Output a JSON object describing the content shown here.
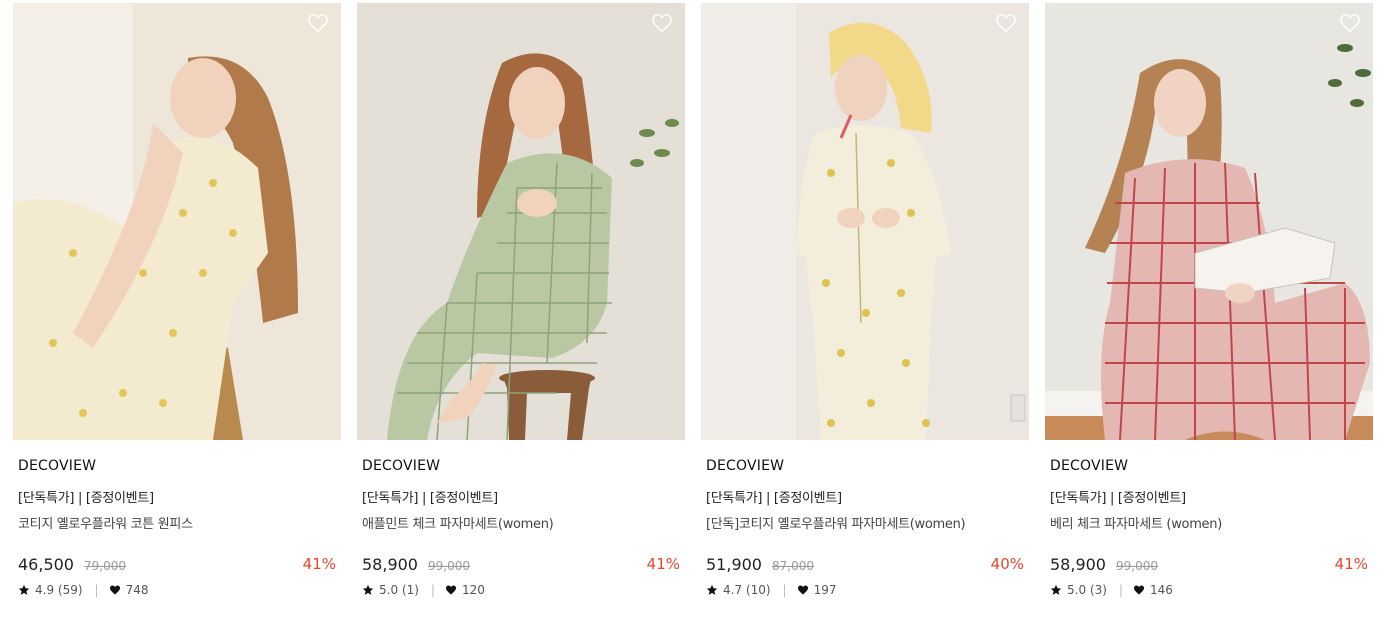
{
  "products": [
    {
      "brand": "DECOVIEW",
      "tags": "[단독특가] | [증정이벤트]",
      "name": "코티지 옐로우플라워 코튼 원피스",
      "price": "46,500",
      "original_price": "79,000",
      "discount": "41%",
      "rating": "4.9 (59)",
      "likes": "748",
      "image": {
        "bg": "#efe6da",
        "outfit": "#f4ead0",
        "pattern": "#e3c65a",
        "hair": "#b07a4a",
        "prop": "#b88a4e"
      }
    },
    {
      "brand": "DECOVIEW",
      "tags": "[단독특가] | [증정이벤트]",
      "name": "애플민트 체크 파자마세트(women)",
      "price": "58,900",
      "original_price": "99,000",
      "discount": "41%",
      "rating": "5.0 (1)",
      "likes": "120",
      "image": {
        "bg": "#e4e0d8",
        "outfit": "#b9c7a2",
        "pattern": "#8ea37a",
        "hair": "#a6683f",
        "prop": "#8a5c3a"
      }
    },
    {
      "brand": "DECOVIEW",
      "tags": "[단독특가] | [증정이벤트]",
      "name": "[단독]코티지 옐로우플라워 파자마세트(women)",
      "price": "51,900",
      "original_price": "87,000",
      "discount": "40%",
      "rating": "4.7 (10)",
      "likes": "197",
      "image": {
        "bg": "#ebe6df",
        "outfit": "#f3eedc",
        "pattern": "#e0c250",
        "hair": "#f2d98a",
        "prop": "#d9d4cc"
      }
    },
    {
      "brand": "DECOVIEW",
      "tags": "[단독특가] | [증정이벤트]",
      "name": "베리 체크 파자마세트 (women)",
      "price": "58,900",
      "original_price": "99,000",
      "discount": "41%",
      "rating": "5.0 (3)",
      "likes": "146",
      "image": {
        "bg": "#e8e6e1",
        "outfit": "#e4b7b3",
        "pattern": "#c0464a",
        "hair": "#b58253",
        "prop": "#cfd3d6"
      }
    }
  ],
  "colors": {
    "discount": "#e8442e",
    "text": "#222222",
    "muted": "#999999"
  },
  "icons": {
    "wishlist": "heart-outline-icon",
    "rating": "star-icon",
    "likes": "heart-icon"
  }
}
